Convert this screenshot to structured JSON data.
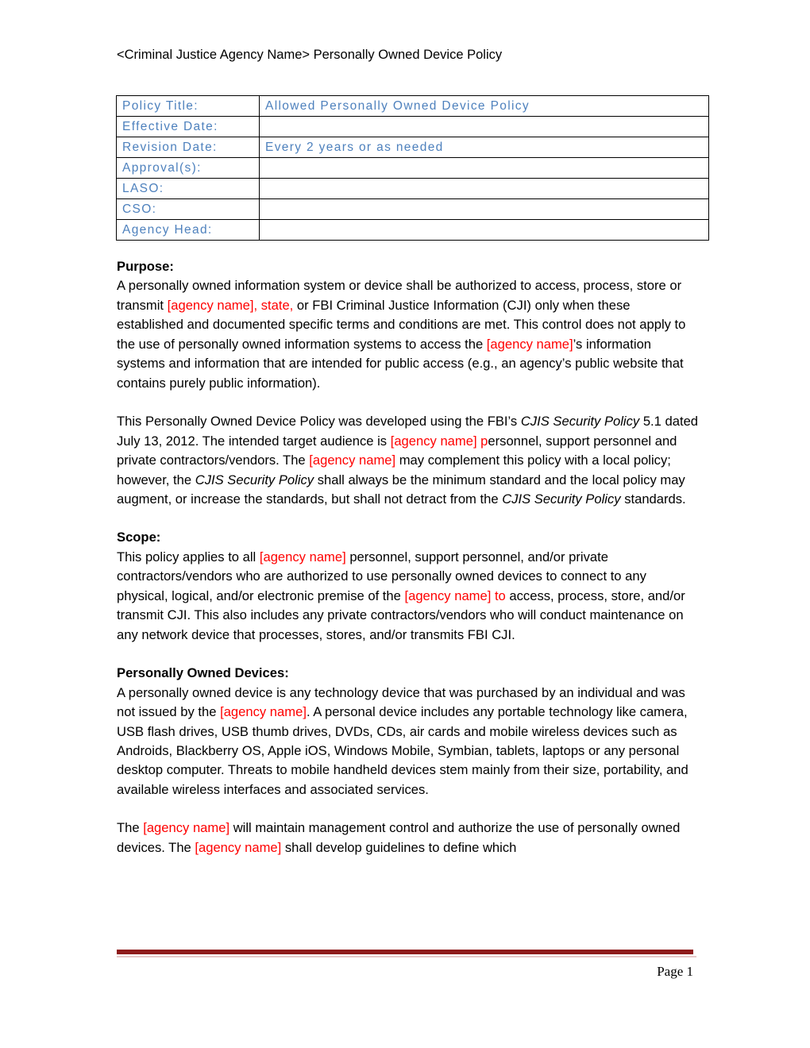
{
  "document": {
    "running_header": "<Criminal Justice Agency Name> Personally Owned Device Policy"
  },
  "info_table": {
    "rows": [
      {
        "label": "Policy Title:",
        "value": "Allowed Personally Owned Device Policy"
      },
      {
        "label": "Effective Date:",
        "value": ""
      },
      {
        "label": "Revision Date:",
        "value": "Every 2 years or as needed"
      },
      {
        "label": "Approval(s):",
        "value": ""
      },
      {
        "label": "LASO:",
        "value": ""
      },
      {
        "label": "CSO:",
        "value": ""
      },
      {
        "label": "Agency Head:",
        "value": ""
      }
    ]
  },
  "sections": {
    "purpose": {
      "heading": "Purpose:",
      "p1_a": "A personally owned information system or device shall be authorized to access, process, store or transmit ",
      "p1_ph1": "[agency name], state,",
      "p1_b": " or FBI Criminal Justice Information (CJI) only when these established and documented specific terms and conditions are met.  This control does not apply to the use of personally owned information systems to access the ",
      "p1_ph2": "[agency name]",
      "p1_c": "’s information systems and information that are intended for public access (e.g., an agency’s public website that contains purely public information).",
      "p2_a": "This Personally Owned Device Policy was developed using the FBI’s ",
      "p2_it1": "CJIS Security Policy",
      "p2_b": " 5.1 dated July 13, 2012. The intended target audience is ",
      "p2_ph1": "[agency name] p",
      "p2_c": "ersonnel, support personnel and private contractors/vendors.  The ",
      "p2_ph2": "[agency name]",
      "p2_d": " may complement this policy with a local policy; however, the ",
      "p2_it2": "CJIS Security Policy",
      "p2_e": " shall always be the minimum standard and the local policy may augment, or increase the standards, but shall not detract from the ",
      "p2_it3": "CJIS Security Policy",
      "p2_f": " standards."
    },
    "scope": {
      "heading": "Scope:",
      "p1_a": "This policy applies to all ",
      "p1_ph1": "[agency name]",
      "p1_b": " personnel, support personnel, and/or private contractors/vendors who are authorized to use personally owned devices to connect to any physical, logical, and/or electronic premise of the ",
      "p1_ph2": "[agency name] to",
      "p1_c": " access, process, store, and/or transmit CJI.  This also includes any private contractors/vendors who will conduct maintenance on any network device that processes, stores, and/or transmits FBI CJI."
    },
    "devices": {
      "heading": "Personally Owned Devices:",
      "p1_a": "A personally owned device is any technology device that was purchased by an individual and was not issued by the ",
      "p1_ph1": "[agency name]",
      "p1_b": ".  A personal device includes any portable technology like camera, USB flash drives, USB thumb drives, DVDs, CDs, air cards and mobile wireless devices such as Androids, Blackberry OS, Apple iOS, Windows Mobile, Symbian, tablets, laptops or any personal desktop computer.  Threats to mobile handheld devices stem mainly from their size, portability, and available wireless interfaces and associated services.",
      "p2_a": "The ",
      "p2_ph1": "[agency name]",
      "p2_b": " will maintain management control and authorize the use of personally owned devices.  The ",
      "p2_ph2": "[agency name]",
      "p2_c": " shall develop guidelines to define which"
    }
  },
  "footer": {
    "page_label": "Page 1"
  },
  "colors": {
    "table_text": "#4E81BD",
    "placeholder_red": "#FF0000",
    "footer_rule": "#8E1B1B",
    "footer_rule_thin": "#E6C9C9"
  }
}
